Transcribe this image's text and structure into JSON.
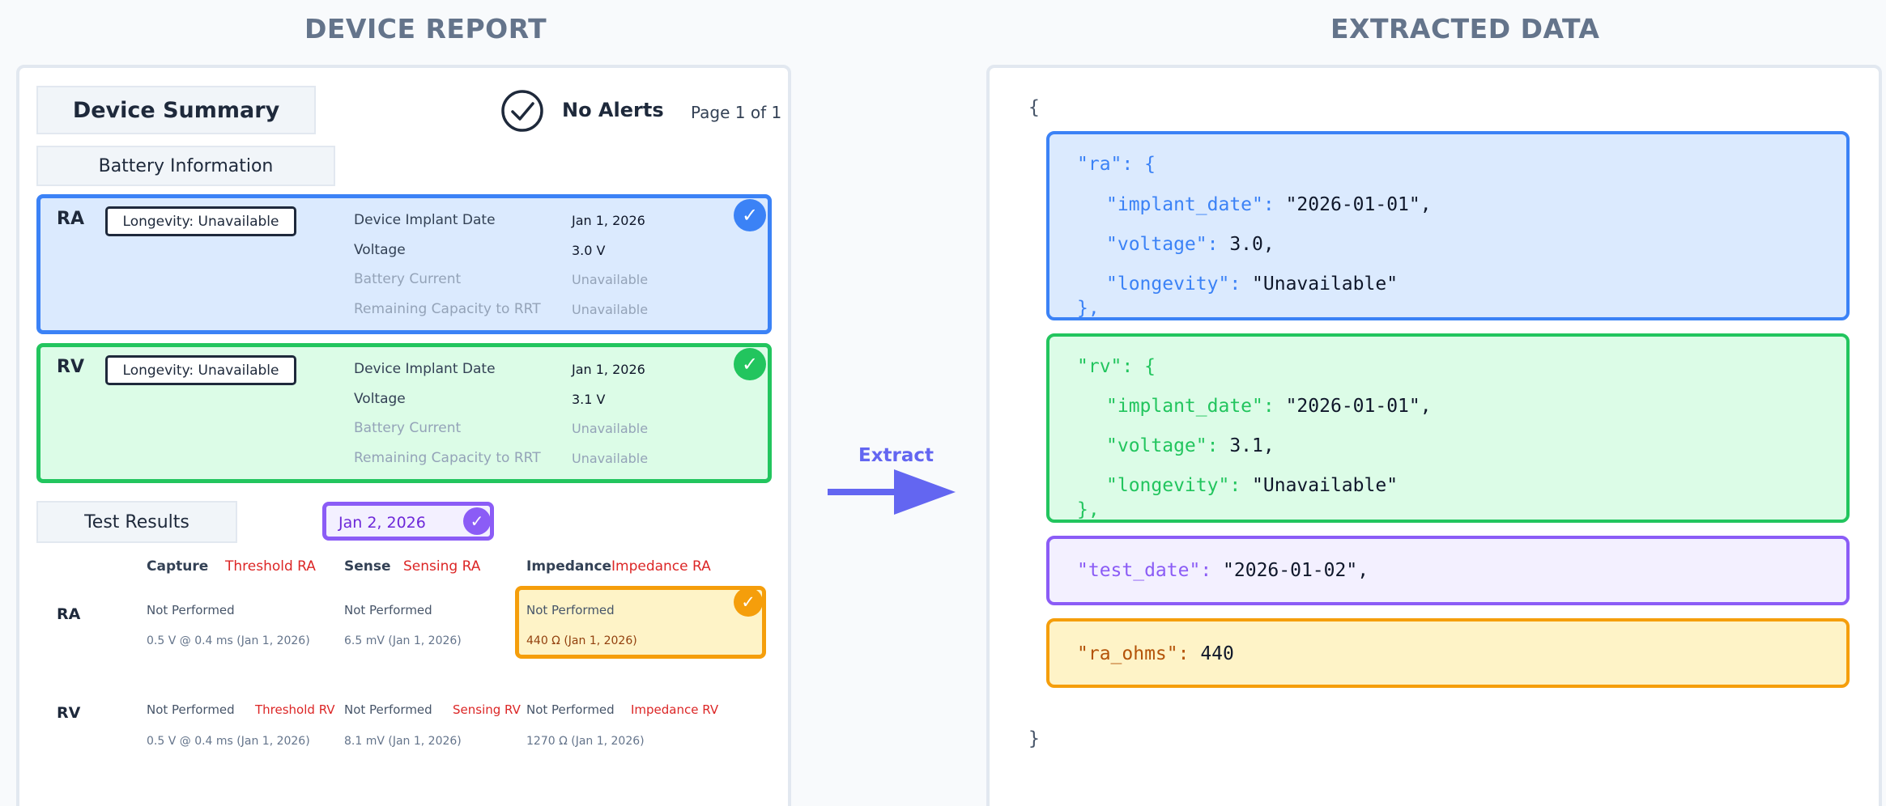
{
  "left_title": "DEVICE REPORT",
  "right_title": "EXTRACTED DATA",
  "report": {
    "summary_label": "Device Summary",
    "alerts_label": "No Alerts",
    "page_label": "Page 1 of 1",
    "battery_label": "Battery Information",
    "ra": {
      "label": "RA",
      "longevity": "Longevity: Unavailable",
      "rows": [
        {
          "label": "Device Implant Date",
          "value": "Jan 1, 2026"
        },
        {
          "label": "Voltage",
          "value": "3.0 V"
        },
        {
          "label": "Battery Current",
          "value": "Unavailable"
        },
        {
          "label": "Remaining Capacity to RRT",
          "value": "Unavailable"
        }
      ]
    },
    "rv": {
      "label": "RV",
      "longevity": "Longevity: Unavailable",
      "rows": [
        {
          "label": "Device Implant Date",
          "value": "Jan 1, 2026"
        },
        {
          "label": "Voltage",
          "value": "3.1 V"
        },
        {
          "label": "Battery Current",
          "value": "Unavailable"
        },
        {
          "label": "Remaining Capacity to RRT",
          "value": "Unavailable"
        }
      ]
    },
    "test_results_label": "Test Results",
    "test_date": "Jan 2, 2026",
    "columns": {
      "capture": "Capture",
      "threshold_ra": "Threshold RA",
      "sense": "Sense",
      "sensing_ra": "Sensing RA",
      "impedance": "Impedance",
      "impedance_ra": "Impedance RA"
    },
    "tests": {
      "ra": {
        "label": "RA",
        "capture_status": "Not Performed",
        "capture_value": "0.5 V @ 0.4 ms (Jan 1, 2026)",
        "sense_status": "Not Performed",
        "sense_value": "6.5 mV (Jan 1, 2026)",
        "impedance_status": "Not Performed",
        "impedance_value": "440 Ω (Jan 1, 2026)"
      },
      "rv": {
        "label": "RV",
        "capture_status": "Not Performed",
        "threshold_label": "Threshold RV",
        "capture_value": "0.5 V @ 0.4 ms (Jan 1, 2026)",
        "sense_status": "Not Performed",
        "sensing_label": "Sensing RV",
        "sense_value": "8.1 mV (Jan 1, 2026)",
        "impedance_status": "Not Performed",
        "impedance_label": "Impedance RV",
        "impedance_value": "1270 Ω (Jan 1, 2026)"
      }
    }
  },
  "arrow_label": "Extract",
  "json_view": {
    "open_brace": "{",
    "close_brace": "}",
    "ra_key": "\"ra\"",
    "rv_key": "\"rv\"",
    "obj_open": ": {",
    "obj_close": "},",
    "implant_key": "\"implant_date\"",
    "voltage_key": "\"voltage\"",
    "longevity_key": "\"longevity\"",
    "ra_implant": "\"2026-01-01\",",
    "ra_voltage": "3.0,",
    "ra_longevity": "\"Unavailable\"",
    "rv_implant": "\"2026-01-01\",",
    "rv_voltage": "3.1,",
    "rv_longevity": "\"Unavailable\"",
    "test_date_key": "\"test_date\"",
    "test_date_val": "\"2026-01-02\",",
    "ra_ohms_key": "\"ra_ohms\"",
    "ra_ohms_val": "440",
    "colon": ": "
  },
  "colors": {
    "blue": "#3b82f6",
    "green": "#22c55e",
    "purple": "#8b5cf6",
    "orange": "#f59e0b",
    "red": "#dc2626",
    "arrow": "#6366f1"
  }
}
